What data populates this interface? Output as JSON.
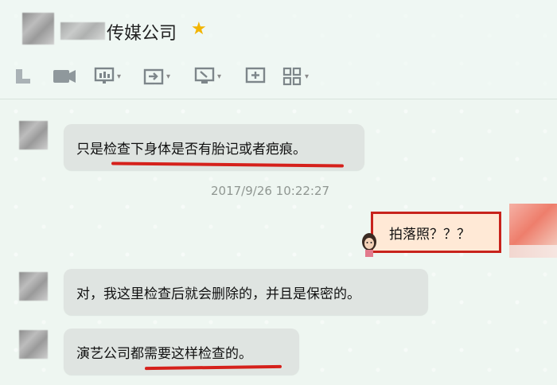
{
  "header": {
    "title": "传媒公司",
    "toolbar": [
      "call-icon",
      "video-icon",
      "screen-share-icon",
      "file-transfer-icon",
      "remote-desktop-icon",
      "add-icon",
      "apps-icon"
    ]
  },
  "messages": [
    {
      "id": "m1",
      "text": "只是检查下身体是否有胎记或者疤痕。"
    },
    {
      "id": "m2",
      "text": "对，我这里检查后就会删除的，并且是保密的。"
    },
    {
      "id": "m3",
      "text": "演艺公司都需要这样检查的。"
    }
  ],
  "timestamp": "2017/9/26 10:22:27",
  "outgoing": {
    "text": "拍落照？？？"
  },
  "colors": {
    "highlight_red": "#d5201b",
    "bubble_gray": "#dfe4e1",
    "star": "#f2b400"
  }
}
